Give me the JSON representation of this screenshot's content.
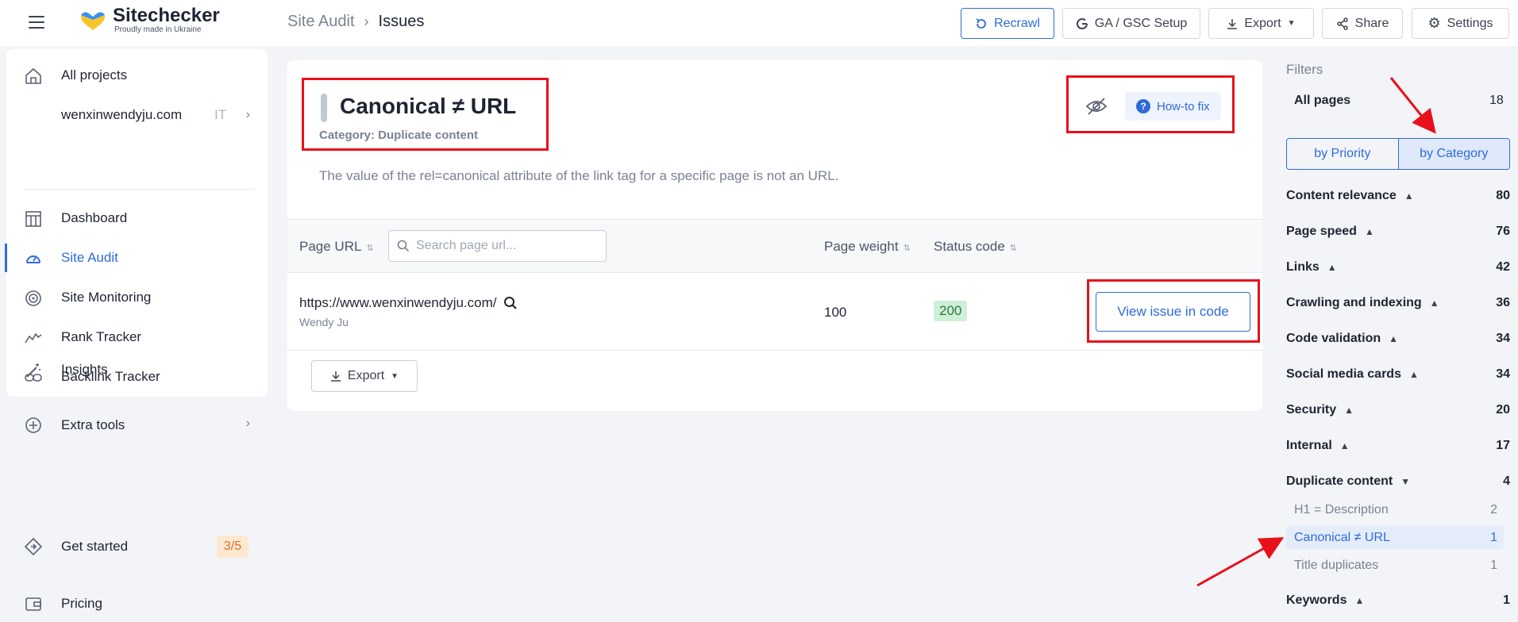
{
  "app": {
    "name": "Sitechecker",
    "tagline": "Proudly made in Ukraine"
  },
  "breadcrumb": {
    "parent": "Site Audit",
    "separator": "›",
    "current": "Issues"
  },
  "toolbar": {
    "recrawl": "Recrawl",
    "ga_setup": "GA / GSC Setup",
    "export": "Export",
    "share": "Share",
    "settings": "Settings"
  },
  "sidebar": {
    "all_projects": "All projects",
    "project": {
      "name": "wenxinwendyju.com",
      "tag": "IT"
    },
    "items": [
      {
        "label": "Dashboard",
        "icon": "dashboard-icon"
      },
      {
        "label": "Site Audit",
        "icon": "gauge-icon"
      },
      {
        "label": "Site Monitoring",
        "icon": "monitoring-icon"
      },
      {
        "label": "Rank Tracker",
        "icon": "rank-icon"
      },
      {
        "label": "Backlink Tracker",
        "icon": "link-icon"
      },
      {
        "label": "Insights",
        "icon": "magic-wand-icon"
      }
    ],
    "extra_tools": "Extra tools",
    "get_started": {
      "label": "Get started",
      "progress": "3/5"
    },
    "pricing": "Pricing"
  },
  "issue": {
    "title": "Canonical ≠ URL",
    "category": "Category: Duplicate content",
    "description": "The value of the rel=canonical attribute of the link tag for a specific page is not an URL.",
    "howto": "How-to fix"
  },
  "table": {
    "headers": {
      "url": "Page URL",
      "weight": "Page weight",
      "status": "Status code"
    },
    "search_placeholder": "Search page url...",
    "rows": [
      {
        "url": "https://www.wenxinwendyju.com/",
        "title": "Wendy Ju",
        "weight": "100",
        "status": "200",
        "action": "View issue in code"
      }
    ],
    "export": "Export"
  },
  "filters": {
    "title": "Filters",
    "all_pages": {
      "label": "All pages",
      "count": "18"
    },
    "by_priority": "by Priority",
    "by_category": "by Category",
    "categories": [
      {
        "label": "Content relevance",
        "count": "80"
      },
      {
        "label": "Page speed",
        "count": "76"
      },
      {
        "label": "Links",
        "count": "42"
      },
      {
        "label": "Crawling and indexing",
        "count": "36"
      },
      {
        "label": "Code validation",
        "count": "34"
      },
      {
        "label": "Social media cards",
        "count": "34"
      },
      {
        "label": "Security",
        "count": "20"
      },
      {
        "label": "Internal",
        "count": "17"
      },
      {
        "label": "Duplicate content",
        "count": "4"
      }
    ],
    "duplicate_sub": [
      {
        "label": "H1 = Description",
        "count": "2"
      },
      {
        "label": "Canonical ≠ URL",
        "count": "1"
      },
      {
        "label": "Title duplicates",
        "count": "1"
      }
    ],
    "keywords": {
      "label": "Keywords",
      "count": "1"
    }
  },
  "colors": {
    "accent": "#2f6bd9",
    "annotation": "#e8101b",
    "status_ok_bg": "#cdf0d7"
  }
}
